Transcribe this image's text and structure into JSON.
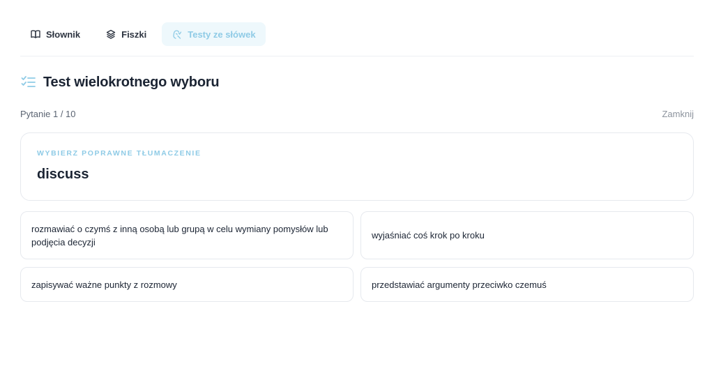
{
  "nav": {
    "tabs": [
      {
        "label": "Słownik",
        "icon": "book-open-icon",
        "active": false
      },
      {
        "label": "Fiszki",
        "icon": "layers-icon",
        "active": false
      },
      {
        "label": "Testy ze słówek",
        "icon": "brain-icon",
        "active": true
      }
    ]
  },
  "test": {
    "title": "Test wielokrotnego wyboru",
    "title_icon": "checklist-icon",
    "progress": "Pytanie 1 / 10",
    "close_label": "Zamknij"
  },
  "question": {
    "hint": "WYBIERZ POPRAWNE TŁUMACZENIE",
    "word": "discuss"
  },
  "answers": [
    "rozmawiać o czymś z inną osobą lub grupą w celu wymiany pomysłów lub podjęcia decyzji",
    "wyjaśniać coś krok po kroku",
    "zapisywać ważne punkty z rozmowy",
    "przedstawiać argumenty przeciwko czemuś"
  ],
  "colors": {
    "accent": "#8fcbe6",
    "accent_bg": "#eef8fc",
    "text": "#1b2433",
    "muted": "#8c939d",
    "border": "#e6e9ee"
  }
}
